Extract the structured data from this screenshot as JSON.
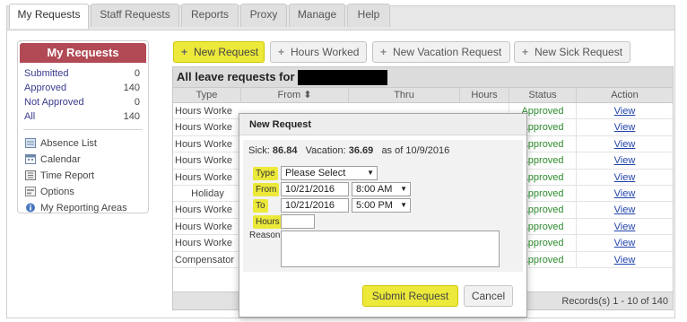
{
  "tabs": [
    "My Requests",
    "Staff Requests",
    "Reports",
    "Proxy",
    "Manage",
    "Help"
  ],
  "sidebar": {
    "title": "My Requests",
    "counts": [
      {
        "label": "Submitted",
        "value": "0"
      },
      {
        "label": "Approved",
        "value": "140"
      },
      {
        "label": "Not Approved",
        "value": "0"
      },
      {
        "label": "All",
        "value": "140"
      }
    ],
    "nav": [
      {
        "label": "Absence List",
        "icon": "list-icon"
      },
      {
        "label": "Calendar",
        "icon": "calendar-icon"
      },
      {
        "label": "Time Report",
        "icon": "report-icon"
      },
      {
        "label": "Options",
        "icon": "options-icon"
      },
      {
        "label": "My Reporting Areas",
        "icon": "info-icon"
      }
    ]
  },
  "toolbar": {
    "new_request": "New Request",
    "hours_worked": "Hours Worked",
    "new_vacation": "New Vacation Request",
    "new_sick": "New Sick Request"
  },
  "table": {
    "title": "All leave requests for",
    "columns": [
      "Type",
      "From ⬍",
      "Thru",
      "Hours",
      "Status",
      "Action"
    ],
    "rows": [
      {
        "type": "Hours Worke",
        "status": "Approved",
        "action": "View"
      },
      {
        "type": "Hours Worke",
        "status": "Approved",
        "action": "View"
      },
      {
        "type": "Hours Worke",
        "status": "Approved",
        "action": "View"
      },
      {
        "type": "Hours Worke",
        "status": "Approved",
        "action": "View"
      },
      {
        "type": "Hours Worke",
        "status": "Approved",
        "action": "View"
      },
      {
        "type": "Holiday",
        "status": "Approved",
        "action": "View"
      },
      {
        "type": "Hours Worke",
        "status": "Approved",
        "action": "View"
      },
      {
        "type": "Hours Worke",
        "status": "Approved",
        "action": "View"
      },
      {
        "type": "Hours Worke",
        "status": "Approved",
        "action": "View"
      },
      {
        "type": "Compensator",
        "status": "Approved",
        "action": "View"
      }
    ],
    "footer": "Records(s) 1 - 10 of 140"
  },
  "modal": {
    "title": "New Request",
    "sick_label": "Sick:",
    "sick_value": "86.84",
    "vacation_label": "Vacation:",
    "vacation_value": "36.69",
    "as_of": "as of 10/9/2016",
    "type_label": "Type",
    "type_value": "Please Select",
    "from_label": "From",
    "from_date": "10/21/2016",
    "from_time": "8:00 AM",
    "to_label": "To",
    "to_date": "10/21/2016",
    "to_time": "5:00 PM",
    "hours_label": "Hours",
    "hours_value": "",
    "reason_label": "Reason",
    "reason_value": "",
    "submit": "Submit Request",
    "cancel": "Cancel"
  },
  "colors": {
    "accent_yellow": "#ece93a",
    "sidebar_header": "#b14a55",
    "approved_green": "#2e8b2e",
    "link_blue": "#2244aa"
  }
}
